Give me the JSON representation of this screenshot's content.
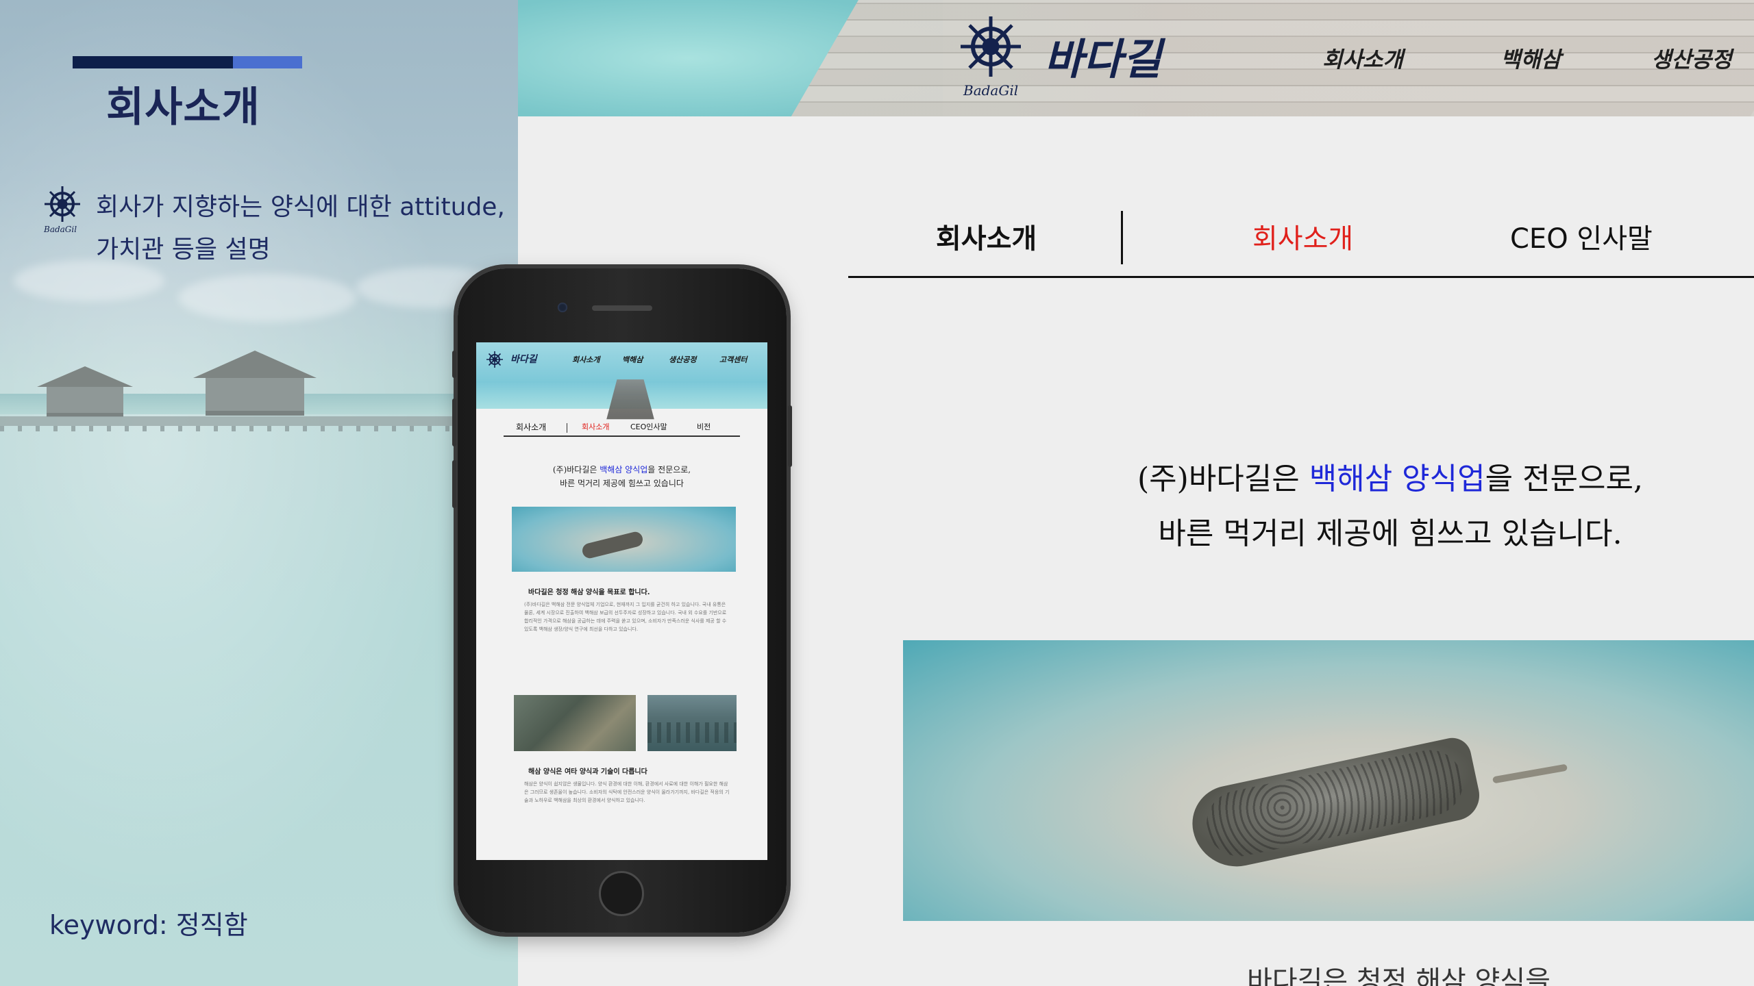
{
  "left_panel": {
    "title": "회사소개",
    "description_line1": "회사가 지향하는 양식에 대한 attitude,",
    "description_line2": "가치관 등을 설명",
    "keyword": "keyword: 정직함",
    "icon_brand": "BadaGil"
  },
  "site": {
    "brand_ko": "바다길",
    "brand_en": "BadaGil",
    "nav": [
      "회사소개",
      "백해삼",
      "생산공정"
    ],
    "tabs": {
      "section": "회사소개",
      "active": "회사소개",
      "ceo": "CEO 인사말"
    },
    "lead": {
      "pre": "(주)바다길은 ",
      "highlight": "백해삼 양식업",
      "post": "을 전문으로,",
      "line2": "바른 먹거리 제공에 힘쓰고 있습니다."
    },
    "cut_text": "바다길은 청정 해삼 양식을"
  },
  "mobile": {
    "brand": "바다길",
    "nav": [
      "회사소개",
      "백해삼",
      "생산공정",
      "고객센터"
    ],
    "tabs": [
      "회사소개",
      "회사소개",
      "CEO인사말",
      "비전"
    ],
    "lead": {
      "pre": "(주)바다길은 ",
      "highlight": "백해삼 양식업",
      "post": "을 전문으로,",
      "line2": "바른 먹거리 제공에 힘쓰고 있습니다"
    },
    "heading1": "바다길은 청정 해삼 양식을 목표로 합니다.",
    "body1": "(주)바다길은 백해삼 전문 양식업체 기업으로, 현재까지 그 입지를 굳건히 하고 있습니다. 국내 유통은 물론, 세계 시장으로 진출하여 백해삼 보급의 선두주자로 성장하고 있습니다. 국내 외 수요를 기반으로 합리적인 가격으로 해삼을 공급하는 데에 주력을 쏟고 있으며, 소비자가 만족스러운 식사를 제공 할 수 있도록 백해삼 생장/양식 연구에 최선을 다하고 있습니다.",
    "heading2": "해삼 양식은 여타 양식과 기술이 다릅니다",
    "body2": "해삼은 양식이 쉽지않은 생물입니다. 양식 환경에 대한 이해, 환경에서 사료에 대한 이해가 필요한 해삼은 그러므로 생존율이 높습니다. 소비자의 식탁에 안전스러운 양식이 올라가기까지, 바다길은 적응의 기술과 노하우로 백해삼을 최상의 환경에서 양식하고 있습니다."
  },
  "colors": {
    "title_dark": "#1a2556",
    "bar_dark": "#0d1f4a",
    "bar_accent": "#4a6fd0",
    "tab_active": "#e0201b",
    "highlight": "#1e28d8"
  }
}
